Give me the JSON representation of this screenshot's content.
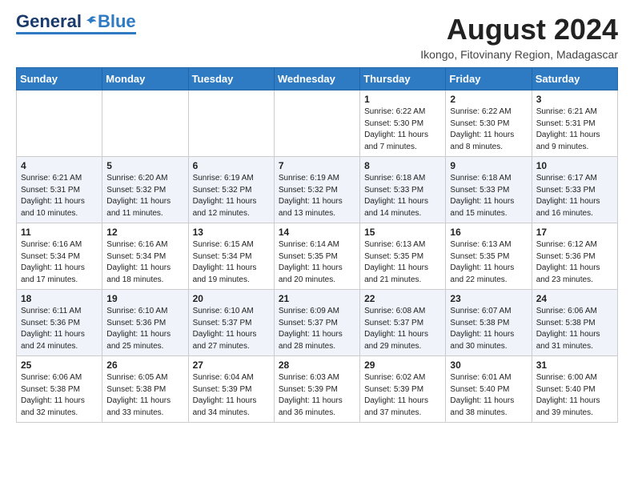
{
  "header": {
    "logo_general": "General",
    "logo_blue": "Blue",
    "month_year": "August 2024",
    "location": "Ikongo, Fitovinany Region, Madagascar"
  },
  "days_of_week": [
    "Sunday",
    "Monday",
    "Tuesday",
    "Wednesday",
    "Thursday",
    "Friday",
    "Saturday"
  ],
  "weeks": [
    [
      {
        "day": "",
        "sunrise": "",
        "sunset": "",
        "daylight": ""
      },
      {
        "day": "",
        "sunrise": "",
        "sunset": "",
        "daylight": ""
      },
      {
        "day": "",
        "sunrise": "",
        "sunset": "",
        "daylight": ""
      },
      {
        "day": "",
        "sunrise": "",
        "sunset": "",
        "daylight": ""
      },
      {
        "day": "1",
        "sunrise": "6:22 AM",
        "sunset": "5:30 PM",
        "daylight": "11 hours and 7 minutes."
      },
      {
        "day": "2",
        "sunrise": "6:22 AM",
        "sunset": "5:30 PM",
        "daylight": "11 hours and 8 minutes."
      },
      {
        "day": "3",
        "sunrise": "6:21 AM",
        "sunset": "5:31 PM",
        "daylight": "11 hours and 9 minutes."
      }
    ],
    [
      {
        "day": "4",
        "sunrise": "6:21 AM",
        "sunset": "5:31 PM",
        "daylight": "11 hours and 10 minutes."
      },
      {
        "day": "5",
        "sunrise": "6:20 AM",
        "sunset": "5:32 PM",
        "daylight": "11 hours and 11 minutes."
      },
      {
        "day": "6",
        "sunrise": "6:19 AM",
        "sunset": "5:32 PM",
        "daylight": "11 hours and 12 minutes."
      },
      {
        "day": "7",
        "sunrise": "6:19 AM",
        "sunset": "5:32 PM",
        "daylight": "11 hours and 13 minutes."
      },
      {
        "day": "8",
        "sunrise": "6:18 AM",
        "sunset": "5:33 PM",
        "daylight": "11 hours and 14 minutes."
      },
      {
        "day": "9",
        "sunrise": "6:18 AM",
        "sunset": "5:33 PM",
        "daylight": "11 hours and 15 minutes."
      },
      {
        "day": "10",
        "sunrise": "6:17 AM",
        "sunset": "5:33 PM",
        "daylight": "11 hours and 16 minutes."
      }
    ],
    [
      {
        "day": "11",
        "sunrise": "6:16 AM",
        "sunset": "5:34 PM",
        "daylight": "11 hours and 17 minutes."
      },
      {
        "day": "12",
        "sunrise": "6:16 AM",
        "sunset": "5:34 PM",
        "daylight": "11 hours and 18 minutes."
      },
      {
        "day": "13",
        "sunrise": "6:15 AM",
        "sunset": "5:34 PM",
        "daylight": "11 hours and 19 minutes."
      },
      {
        "day": "14",
        "sunrise": "6:14 AM",
        "sunset": "5:35 PM",
        "daylight": "11 hours and 20 minutes."
      },
      {
        "day": "15",
        "sunrise": "6:13 AM",
        "sunset": "5:35 PM",
        "daylight": "11 hours and 21 minutes."
      },
      {
        "day": "16",
        "sunrise": "6:13 AM",
        "sunset": "5:35 PM",
        "daylight": "11 hours and 22 minutes."
      },
      {
        "day": "17",
        "sunrise": "6:12 AM",
        "sunset": "5:36 PM",
        "daylight": "11 hours and 23 minutes."
      }
    ],
    [
      {
        "day": "18",
        "sunrise": "6:11 AM",
        "sunset": "5:36 PM",
        "daylight": "11 hours and 24 minutes."
      },
      {
        "day": "19",
        "sunrise": "6:10 AM",
        "sunset": "5:36 PM",
        "daylight": "11 hours and 25 minutes."
      },
      {
        "day": "20",
        "sunrise": "6:10 AM",
        "sunset": "5:37 PM",
        "daylight": "11 hours and 27 minutes."
      },
      {
        "day": "21",
        "sunrise": "6:09 AM",
        "sunset": "5:37 PM",
        "daylight": "11 hours and 28 minutes."
      },
      {
        "day": "22",
        "sunrise": "6:08 AM",
        "sunset": "5:37 PM",
        "daylight": "11 hours and 29 minutes."
      },
      {
        "day": "23",
        "sunrise": "6:07 AM",
        "sunset": "5:38 PM",
        "daylight": "11 hours and 30 minutes."
      },
      {
        "day": "24",
        "sunrise": "6:06 AM",
        "sunset": "5:38 PM",
        "daylight": "11 hours and 31 minutes."
      }
    ],
    [
      {
        "day": "25",
        "sunrise": "6:06 AM",
        "sunset": "5:38 PM",
        "daylight": "11 hours and 32 minutes."
      },
      {
        "day": "26",
        "sunrise": "6:05 AM",
        "sunset": "5:38 PM",
        "daylight": "11 hours and 33 minutes."
      },
      {
        "day": "27",
        "sunrise": "6:04 AM",
        "sunset": "5:39 PM",
        "daylight": "11 hours and 34 minutes."
      },
      {
        "day": "28",
        "sunrise": "6:03 AM",
        "sunset": "5:39 PM",
        "daylight": "11 hours and 36 minutes."
      },
      {
        "day": "29",
        "sunrise": "6:02 AM",
        "sunset": "5:39 PM",
        "daylight": "11 hours and 37 minutes."
      },
      {
        "day": "30",
        "sunrise": "6:01 AM",
        "sunset": "5:40 PM",
        "daylight": "11 hours and 38 minutes."
      },
      {
        "day": "31",
        "sunrise": "6:00 AM",
        "sunset": "5:40 PM",
        "daylight": "11 hours and 39 minutes."
      }
    ]
  ],
  "labels": {
    "sunrise": "Sunrise:",
    "sunset": "Sunset:",
    "daylight": "Daylight:"
  }
}
